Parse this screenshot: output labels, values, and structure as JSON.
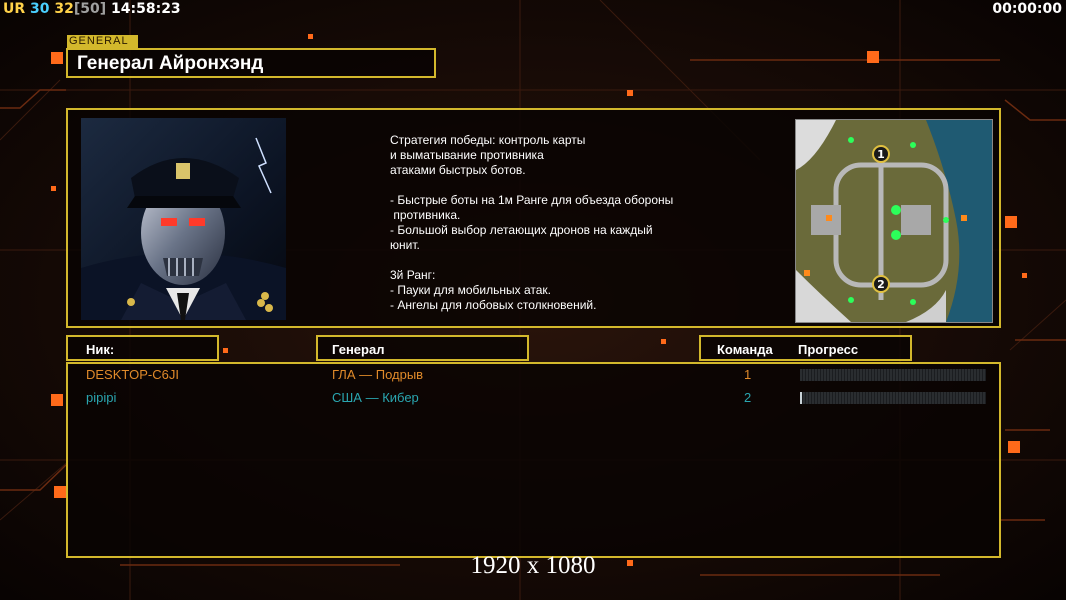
{
  "hud": {
    "ur": "UR",
    "fps1": "30",
    "fps2": "32",
    "fps_limit": "[50]",
    "clock": "14:58:23",
    "timer": "00:00:00"
  },
  "section_tag": "GENERAL",
  "general_name": "Генерал Айронхэнд",
  "description": "Стратегия победы: контроль карты\nи выматывание противника\nатаками быстрых ботов.\n\n- Быстрые боты на 1м Ранге для объезда обороны\n противника.\n- Большой выбор летающих дронов на каждый\nюнит.\n\n3й Ранг:\n- Пауки для мобильных атак.\n- Ангелы для лобовых столкновений.",
  "table": {
    "col_nick": "Ник:",
    "col_general": "Генерал",
    "col_team": "Команда",
    "col_progress": "Прогресс"
  },
  "players": [
    {
      "nick": "DESKTOP-C6JI",
      "general": "ГЛА — Подрыв",
      "team": "1",
      "progress": 0.0,
      "color": "#e08a2a"
    },
    {
      "nick": "pipipi",
      "general": "США — Кибер",
      "team": "2",
      "progress": 0.01,
      "color": "#2aa6b0"
    }
  ],
  "minimap": {
    "marker1": "1",
    "marker2": "2"
  },
  "resolution": "1920 x 1080",
  "colors": {
    "accent": "#d3b82c",
    "player1": "#e08a2a",
    "player2": "#2aa6b0"
  }
}
